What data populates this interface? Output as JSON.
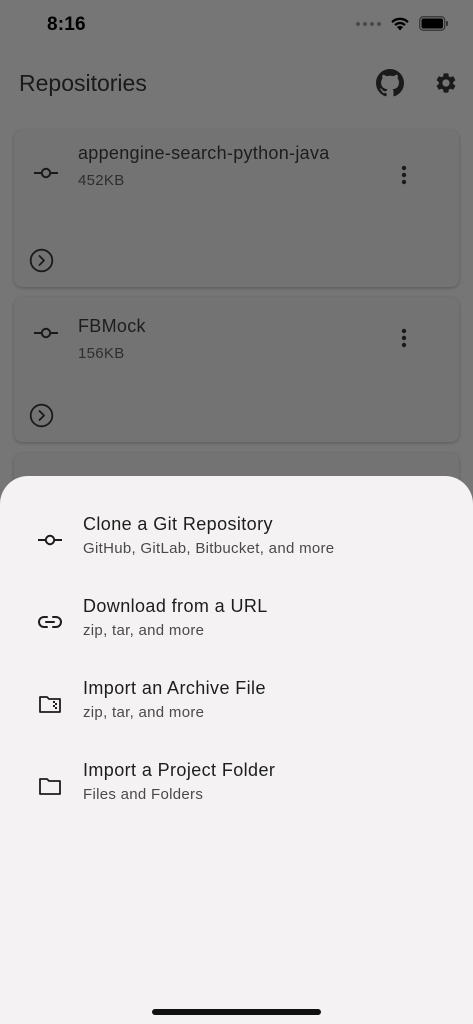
{
  "status_bar": {
    "time": "8:16"
  },
  "app_bar": {
    "title": "Repositories",
    "icons": [
      "github-icon",
      "gear-icon"
    ]
  },
  "repositories": [
    {
      "name": "appengine-search-python-java",
      "size": "452KB"
    },
    {
      "name": "FBMock",
      "size": "156KB"
    }
  ],
  "sheet": {
    "options": [
      {
        "icon": "commit-icon",
        "title": "Clone a Git Repository",
        "subtitle": "GitHub, GitLab, Bitbucket, and more"
      },
      {
        "icon": "link-icon",
        "title": "Download from a URL",
        "subtitle": "zip, tar, and more"
      },
      {
        "icon": "archive-folder-icon",
        "title": "Import an Archive File",
        "subtitle": "zip, tar, and more"
      },
      {
        "icon": "folder-icon",
        "title": "Import a Project Folder",
        "subtitle": "Files and Folders"
      }
    ]
  },
  "colors": {
    "scrim_background": "#777676",
    "card_background": "#747373",
    "sheet_background": "#f4f2f2",
    "text_primary": "#1d1d1d"
  }
}
